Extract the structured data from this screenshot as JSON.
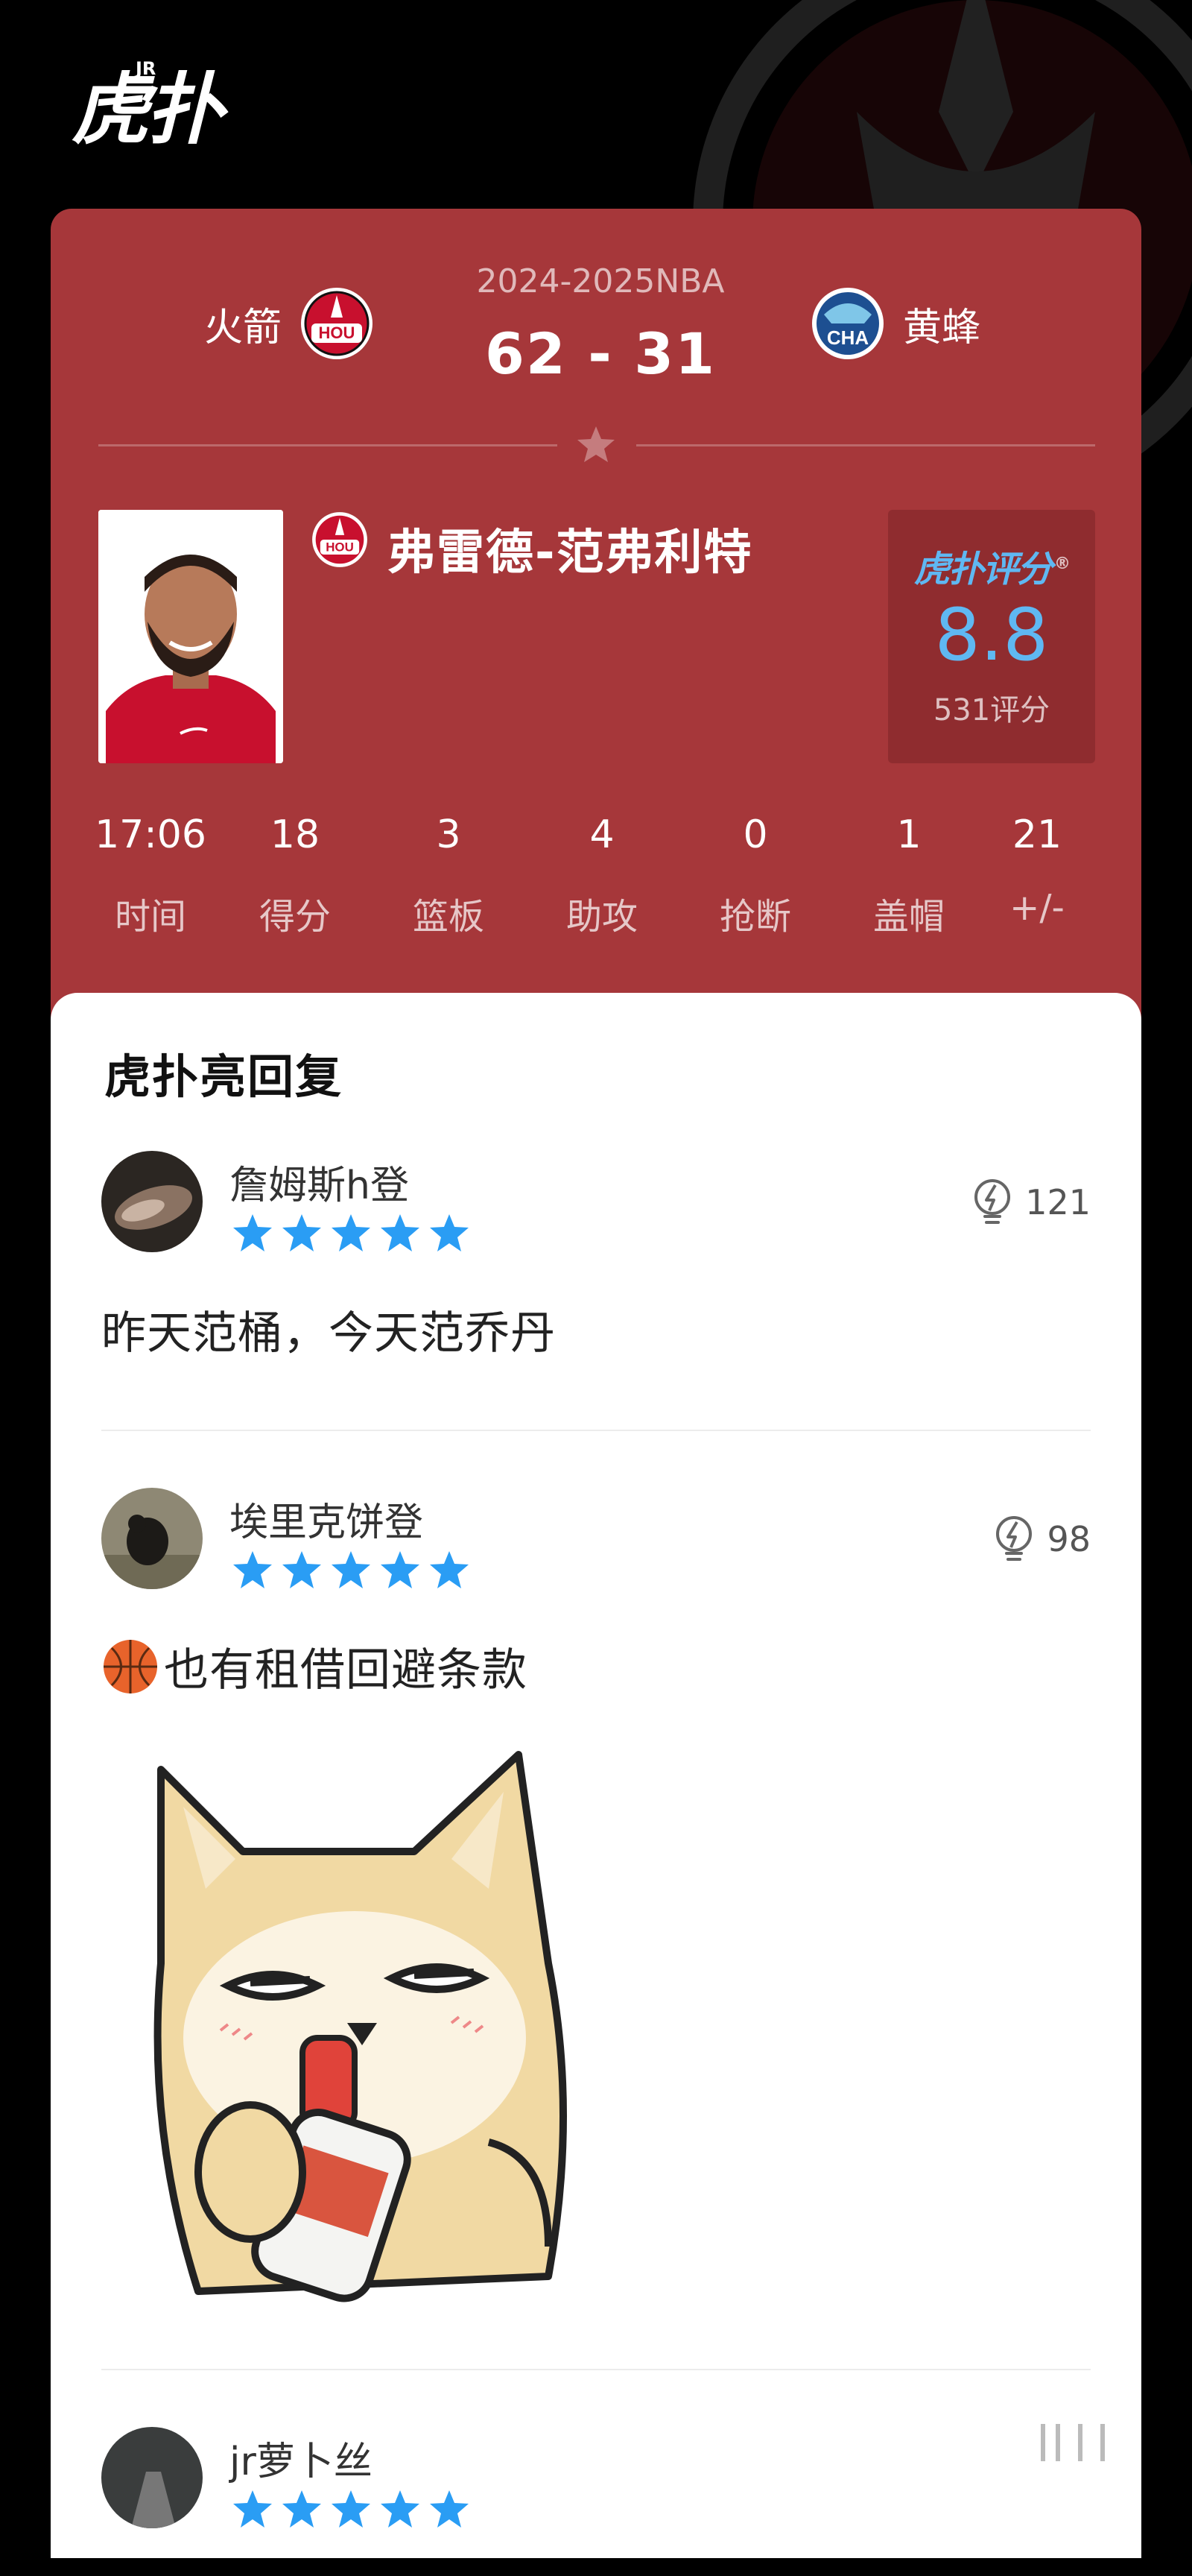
{
  "brand": {
    "logo_text": "虎扑",
    "logo_sup": "JR"
  },
  "match": {
    "season": "2024-2025NBA",
    "score": "62 - 31",
    "home_team": {
      "name": "火箭",
      "abbr": "HOU",
      "color": "#c8102e"
    },
    "away_team": {
      "name": "黄蜂",
      "abbr": "CHA",
      "color": "#1d4f91"
    }
  },
  "player": {
    "name": "弗雷德-范弗利特",
    "team_abbr": "HOU"
  },
  "rating": {
    "brand": "虎扑评分",
    "brand_mark": "®",
    "score": "8.8",
    "count": "531评分"
  },
  "stats": [
    {
      "value": "17:06",
      "label": "时间"
    },
    {
      "value": "18",
      "label": "得分"
    },
    {
      "value": "3",
      "label": "篮板"
    },
    {
      "value": "4",
      "label": "助攻"
    },
    {
      "value": "0",
      "label": "抢断"
    },
    {
      "value": "1",
      "label": "盖帽"
    },
    {
      "value": "21",
      "label": "+/-"
    }
  ],
  "comments_panel": {
    "title": "虎扑亮回复",
    "comments": [
      {
        "username": "詹姆斯h登",
        "stars": 5,
        "lights": "121",
        "text": "昨天范桶，今天范乔丹"
      },
      {
        "username": "埃里克饼登",
        "stars": 5,
        "lights": "98",
        "text": "也有租借回避条款"
      },
      {
        "username": "jr萝卜丝",
        "stars": 5
      }
    ]
  },
  "colors": {
    "card_red": "#a6373a",
    "rating_blue": "#5fb8f2",
    "star_blue": "#2a9df4"
  }
}
